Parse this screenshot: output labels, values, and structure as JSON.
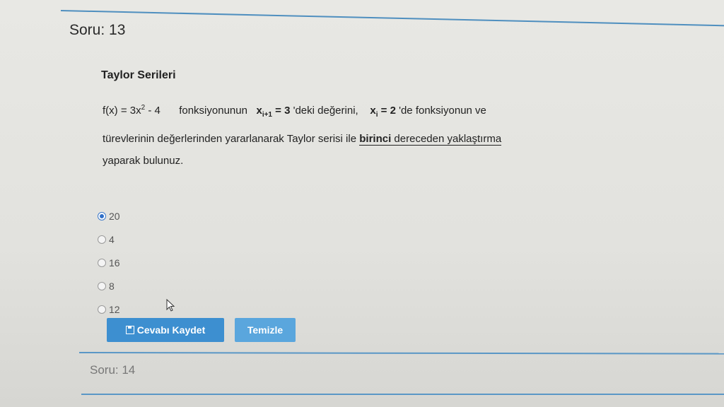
{
  "question": {
    "header": "Soru: 13",
    "title": "Taylor Serileri",
    "line1": {
      "fx_prefix": "f(x) = 3x",
      "fx_exp": "2",
      "fx_suffix": " - 4",
      "text_a": "fonksiyonunun",
      "x_var": "x",
      "sub_1": "i+1",
      "eq_val": " = 3",
      "text_b": " 'deki  değerini,",
      "x_var2": "x",
      "sub_2": "i",
      "eq_val2": " = 2",
      "text_c": " 'de   fonksiyonun ve"
    },
    "line2": {
      "text": "türevlerinin değerlerinden yararlanarak Taylor serisi ile ",
      "underlined_bold": "birinci",
      "underlined": " dereceden yaklaştırma"
    },
    "line3": "yaparak bulunuz."
  },
  "options": [
    {
      "label": "20",
      "checked": true
    },
    {
      "label": "4",
      "checked": false
    },
    {
      "label": "16",
      "checked": false
    },
    {
      "label": "8",
      "checked": false
    },
    {
      "label": "12",
      "checked": false
    }
  ],
  "buttons": {
    "save": "Cevabı Kaydet",
    "clear": "Temizle"
  },
  "next_question": "Soru: 14",
  "colors": {
    "accent": "#3d8fd0",
    "divider": "#5a97c6"
  },
  "icons": {
    "save": "floppy-disk-icon",
    "cursor": "mouse-pointer-icon"
  }
}
